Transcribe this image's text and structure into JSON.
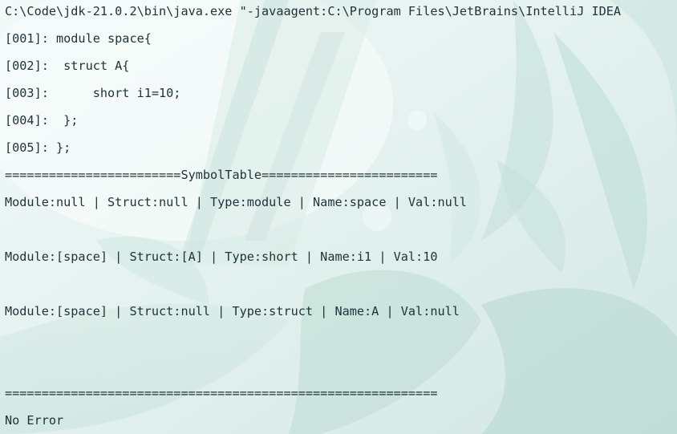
{
  "console": {
    "command": "C:\\Code\\jdk-21.0.2\\bin\\java.exe \"-javaagent:C:\\Program Files\\JetBrains\\IntelliJ IDEA",
    "source_lines": [
      "[001]: module space{",
      "[002]:  struct A{",
      "[003]:      short i1=10;",
      "[004]:  };",
      "[005]: };"
    ],
    "symbol_table_header": "========================SymbolTable========================",
    "symbol_entries": [
      "Module:null | Struct:null | Type:module | Name:space | Val:null",
      "Module:[space] | Struct:[A] | Type:short | Name:i1 | Val:10",
      "Module:[space] | Struct:null | Type:struct | Name:A | Val:null"
    ],
    "separator": "===========================================================",
    "result": "No Error"
  },
  "colors": {
    "text": "#20333a",
    "background": "#eaf5f3"
  }
}
